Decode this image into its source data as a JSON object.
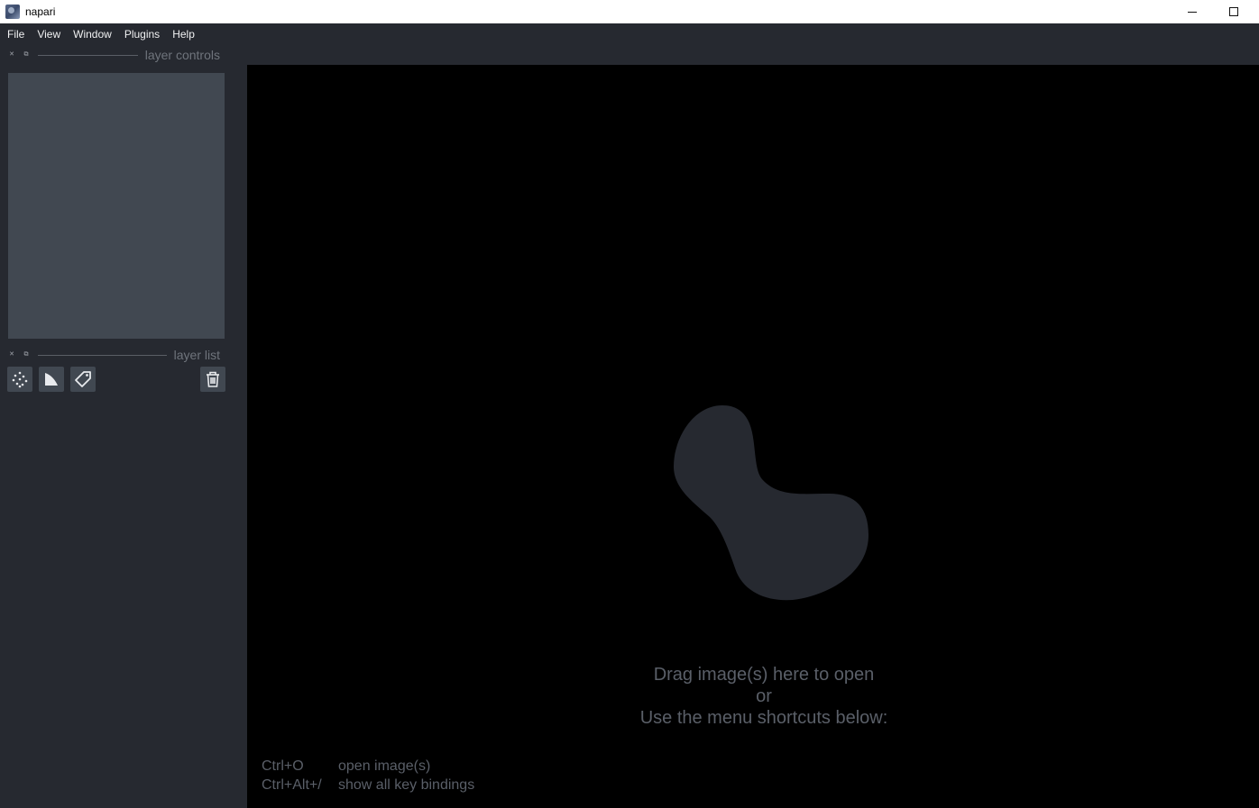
{
  "window": {
    "title": "napari"
  },
  "menu": [
    "File",
    "View",
    "Window",
    "Plugins",
    "Help"
  ],
  "docks": {
    "layer_controls": {
      "title": "layer controls"
    },
    "layer_list": {
      "title": "layer list"
    }
  },
  "layer_buttons": {
    "new_points": "points-icon",
    "new_shapes": "shapes-icon",
    "new_labels": "labels-icon",
    "delete": "trash-icon"
  },
  "welcome": {
    "line1": "Drag image(s) here to open",
    "line2": "or",
    "line3": "Use the menu shortcuts below:"
  },
  "shortcuts": [
    {
      "key": "Ctrl+O",
      "action": "open image(s)"
    },
    {
      "key": "Ctrl+Alt+/",
      "action": "show all key bindings"
    }
  ],
  "colors": {
    "background": "#262930",
    "panel": "#414851",
    "canvas": "#000000",
    "text_muted": "#5a5f68"
  }
}
